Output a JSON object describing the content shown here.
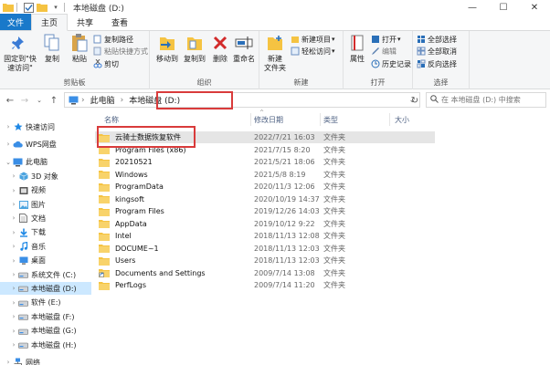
{
  "window": {
    "title": "本地磁盘 (D:)",
    "controls": [
      "—",
      "☐",
      "✕"
    ]
  },
  "tabs": [
    {
      "label": "文件",
      "kind": "file"
    },
    {
      "label": "主页",
      "kind": "active"
    },
    {
      "label": "共享",
      "kind": "normal"
    },
    {
      "label": "查看",
      "kind": "normal"
    }
  ],
  "ribbon": {
    "clipboard": {
      "label": "剪贴板",
      "pin": "固定到\"快速访问\"",
      "copy": "复制",
      "paste": "粘贴",
      "copy_path": "复制路径",
      "paste_shortcut": "粘贴快捷方式",
      "cut": "剪切"
    },
    "organize": {
      "label": "组织",
      "move_to": "移动到",
      "copy_to": "复制到",
      "delete": "删除",
      "rename": "重命名"
    },
    "new": {
      "label": "新建",
      "new_folder": "新建\n文件夹",
      "new_item": "新建项目",
      "easy_access": "轻松访问"
    },
    "open": {
      "label": "打开",
      "properties": "属性",
      "open": "打开",
      "edit": "编辑",
      "history": "历史记录"
    },
    "select": {
      "label": "选择",
      "select_all": "全部选择",
      "select_none": "全部取消",
      "invert": "反向选择"
    }
  },
  "address": {
    "crumbs": [
      "此电脑",
      "本地磁盘 (D:)"
    ],
    "search_placeholder": "在 本地磁盘 (D:) 中搜索"
  },
  "sidebar": [
    {
      "label": "快速访问",
      "icon": "star-icon",
      "level": 0,
      "exp": "›",
      "color": "#1e88e5"
    },
    {
      "label": "WPS网盘",
      "icon": "cloud-icon",
      "level": 0,
      "exp": "›",
      "color": "#3a8ee6"
    },
    {
      "label": "此电脑",
      "icon": "computer-icon",
      "level": 0,
      "exp": "⌄",
      "color": "#3a8ee6"
    },
    {
      "label": "3D 对象",
      "icon": "cube-icon",
      "level": 1,
      "exp": "›",
      "color": "#4aa3df"
    },
    {
      "label": "视频",
      "icon": "video-icon",
      "level": 1,
      "exp": "›",
      "color": "#555"
    },
    {
      "label": "图片",
      "icon": "picture-icon",
      "level": 1,
      "exp": "›",
      "color": "#4aa3df"
    },
    {
      "label": "文档",
      "icon": "document-icon",
      "level": 1,
      "exp": "›",
      "color": "#777"
    },
    {
      "label": "下载",
      "icon": "download-icon",
      "level": 1,
      "exp": "›",
      "color": "#1e88e5"
    },
    {
      "label": "音乐",
      "icon": "music-icon",
      "level": 1,
      "exp": "›",
      "color": "#1e88e5"
    },
    {
      "label": "桌面",
      "icon": "desktop-icon",
      "level": 1,
      "exp": "›",
      "color": "#3a8ee6"
    },
    {
      "label": "系统文件 (C:)",
      "icon": "drive-icon",
      "level": 1,
      "exp": "›",
      "color": "#666"
    },
    {
      "label": "本地磁盘 (D:)",
      "icon": "drive-icon",
      "level": 1,
      "exp": "›",
      "color": "#666",
      "selected": true
    },
    {
      "label": "软件 (E:)",
      "icon": "drive-icon",
      "level": 1,
      "exp": "›",
      "color": "#666"
    },
    {
      "label": "本地磁盘 (F:)",
      "icon": "drive-icon",
      "level": 1,
      "exp": "›",
      "color": "#666"
    },
    {
      "label": "本地磁盘 (G:)",
      "icon": "drive-icon",
      "level": 1,
      "exp": "›",
      "color": "#666"
    },
    {
      "label": "本地磁盘 (H:)",
      "icon": "drive-icon",
      "level": 1,
      "exp": "›",
      "color": "#666"
    },
    {
      "label": "网络",
      "icon": "network-icon",
      "level": 0,
      "exp": "›",
      "color": "#3a8ee6"
    }
  ],
  "columns": [
    "名称",
    "修改日期",
    "类型",
    "大小"
  ],
  "files": [
    {
      "name": "云骑士数据恢复软件",
      "date": "2022/7/21 16:03",
      "type": "文件夹",
      "selected": true,
      "icon": "folder"
    },
    {
      "name": "Program Files (x86)",
      "date": "2021/7/15 8:20",
      "type": "文件夹",
      "icon": "folder"
    },
    {
      "name": "20210521",
      "date": "2021/5/21 18:06",
      "type": "文件夹",
      "icon": "folder"
    },
    {
      "name": "Windows",
      "date": "2021/5/8 8:19",
      "type": "文件夹",
      "icon": "folder"
    },
    {
      "name": "ProgramData",
      "date": "2020/11/3 12:06",
      "type": "文件夹",
      "icon": "folder"
    },
    {
      "name": "kingsoft",
      "date": "2020/10/19 14:37",
      "type": "文件夹",
      "icon": "folder"
    },
    {
      "name": "Program Files",
      "date": "2019/12/26 14:03",
      "type": "文件夹",
      "icon": "folder"
    },
    {
      "name": "AppData",
      "date": "2019/10/12 9:22",
      "type": "文件夹",
      "icon": "folder"
    },
    {
      "name": "Intel",
      "date": "2018/11/13 12:08",
      "type": "文件夹",
      "icon": "folder"
    },
    {
      "name": "DOCUME~1",
      "date": "2018/11/13 12:03",
      "type": "文件夹",
      "icon": "folder"
    },
    {
      "name": "Users",
      "date": "2018/11/13 12:03",
      "type": "文件夹",
      "icon": "folder"
    },
    {
      "name": "Documents and Settings",
      "date": "2009/7/14 13:08",
      "type": "文件夹",
      "icon": "shortcut"
    },
    {
      "name": "PerfLogs",
      "date": "2009/7/14 11:20",
      "type": "文件夹",
      "icon": "folder"
    }
  ]
}
